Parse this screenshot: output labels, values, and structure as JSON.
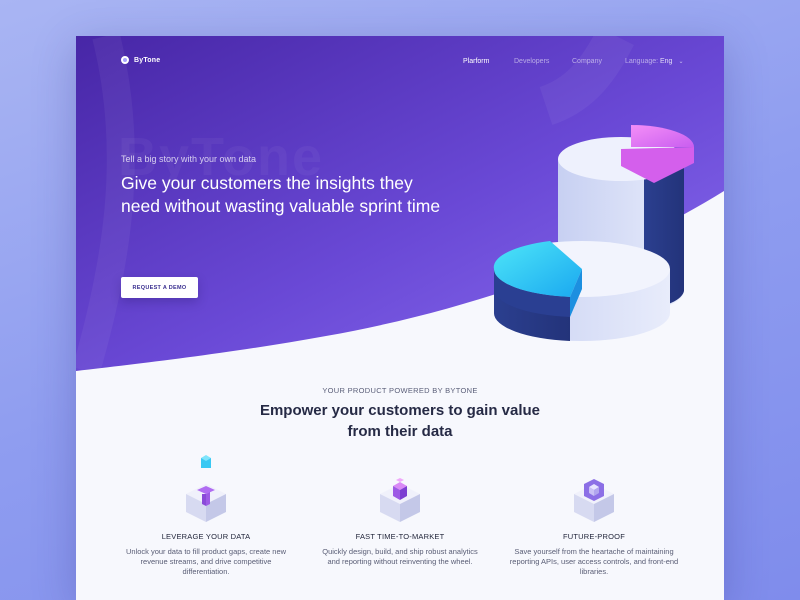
{
  "brand": {
    "name": "ByTone"
  },
  "nav": {
    "links": [
      {
        "label": "Plarform",
        "active": true
      },
      {
        "label": "Developers",
        "active": false
      },
      {
        "label": "Company",
        "active": false
      }
    ],
    "language_label": "Language:",
    "language_value": "Eng"
  },
  "hero": {
    "ghost_text": "ByTone",
    "tagline": "Tell a big story with your own data",
    "headline": "Give your customers the insights they need without wasting valuable sprint time",
    "cta_label": "REQUEST A DEMO"
  },
  "section": {
    "eyebrow": "YOUR PRODUCT POWERED BY BYTONE",
    "title": "Empower your customers to gain value from their data"
  },
  "features": [
    {
      "icon": "data-cube-icon",
      "title": "LEVERAGE YOUR DATA",
      "description": "Unlock your data to fill product gaps, create new revenue streams, and drive competitive differentiation."
    },
    {
      "icon": "stacked-cubes-icon",
      "title": "FAST TIME-TO-MARKET",
      "description": "Quickly design, build, and ship robust analytics and reporting without reinventing the wheel."
    },
    {
      "icon": "shield-cube-icon",
      "title": "FUTURE-PROOF",
      "description": "Save yourself from the heartache of maintaining reporting APIs, user access controls, and front-end libraries."
    }
  ],
  "colors": {
    "hero_start": "#4a2aa8",
    "hero_end": "#7f62e6",
    "accent_pink": "#e86ef3",
    "accent_cyan": "#2fd6f6",
    "text_dark": "#262a45"
  }
}
